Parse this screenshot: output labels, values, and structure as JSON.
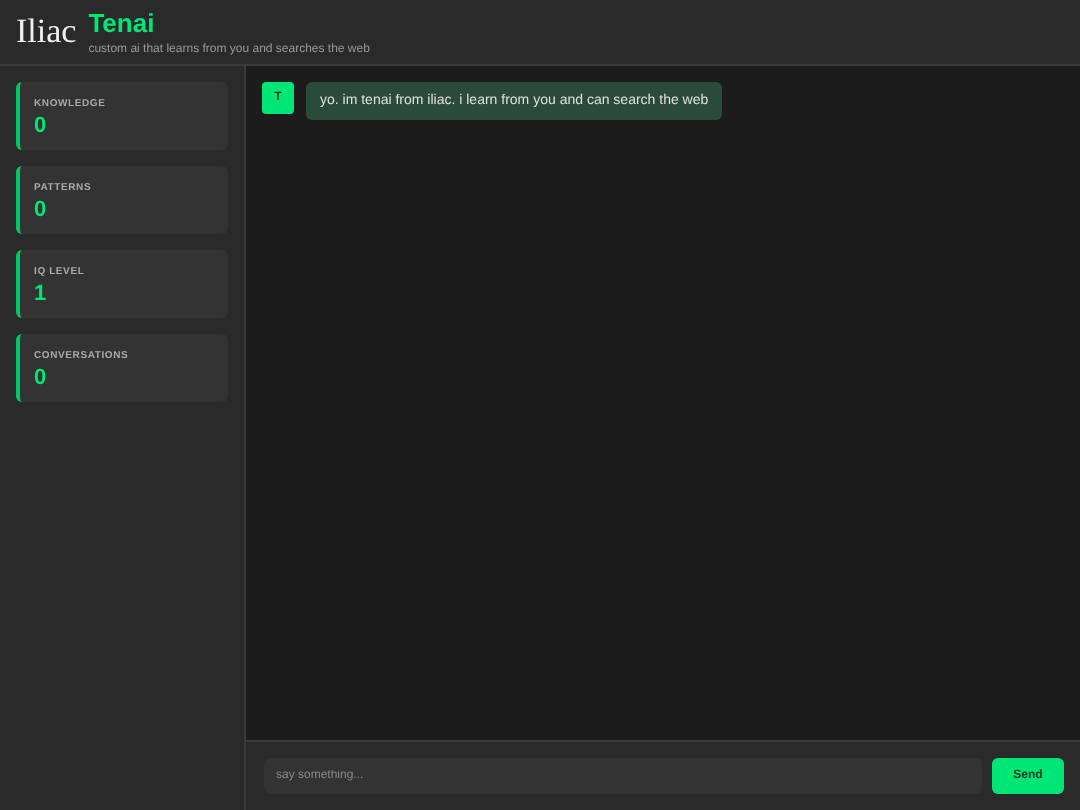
{
  "header": {
    "logo": "Iliac",
    "title": "Tenai",
    "subtitle": "custom ai that learns from you and searches the web"
  },
  "stats": [
    {
      "label": "KNOWLEDGE",
      "value": "0"
    },
    {
      "label": "PATTERNS",
      "value": "0"
    },
    {
      "label": "IQ LEVEL",
      "value": "1"
    },
    {
      "label": "CONVERSATIONS",
      "value": "0"
    }
  ],
  "messages": [
    {
      "avatar": "T",
      "text": "yo. im tenai from iliac. i learn from you and can search the web"
    }
  ],
  "composer": {
    "placeholder": "say something...",
    "button": "Send"
  }
}
